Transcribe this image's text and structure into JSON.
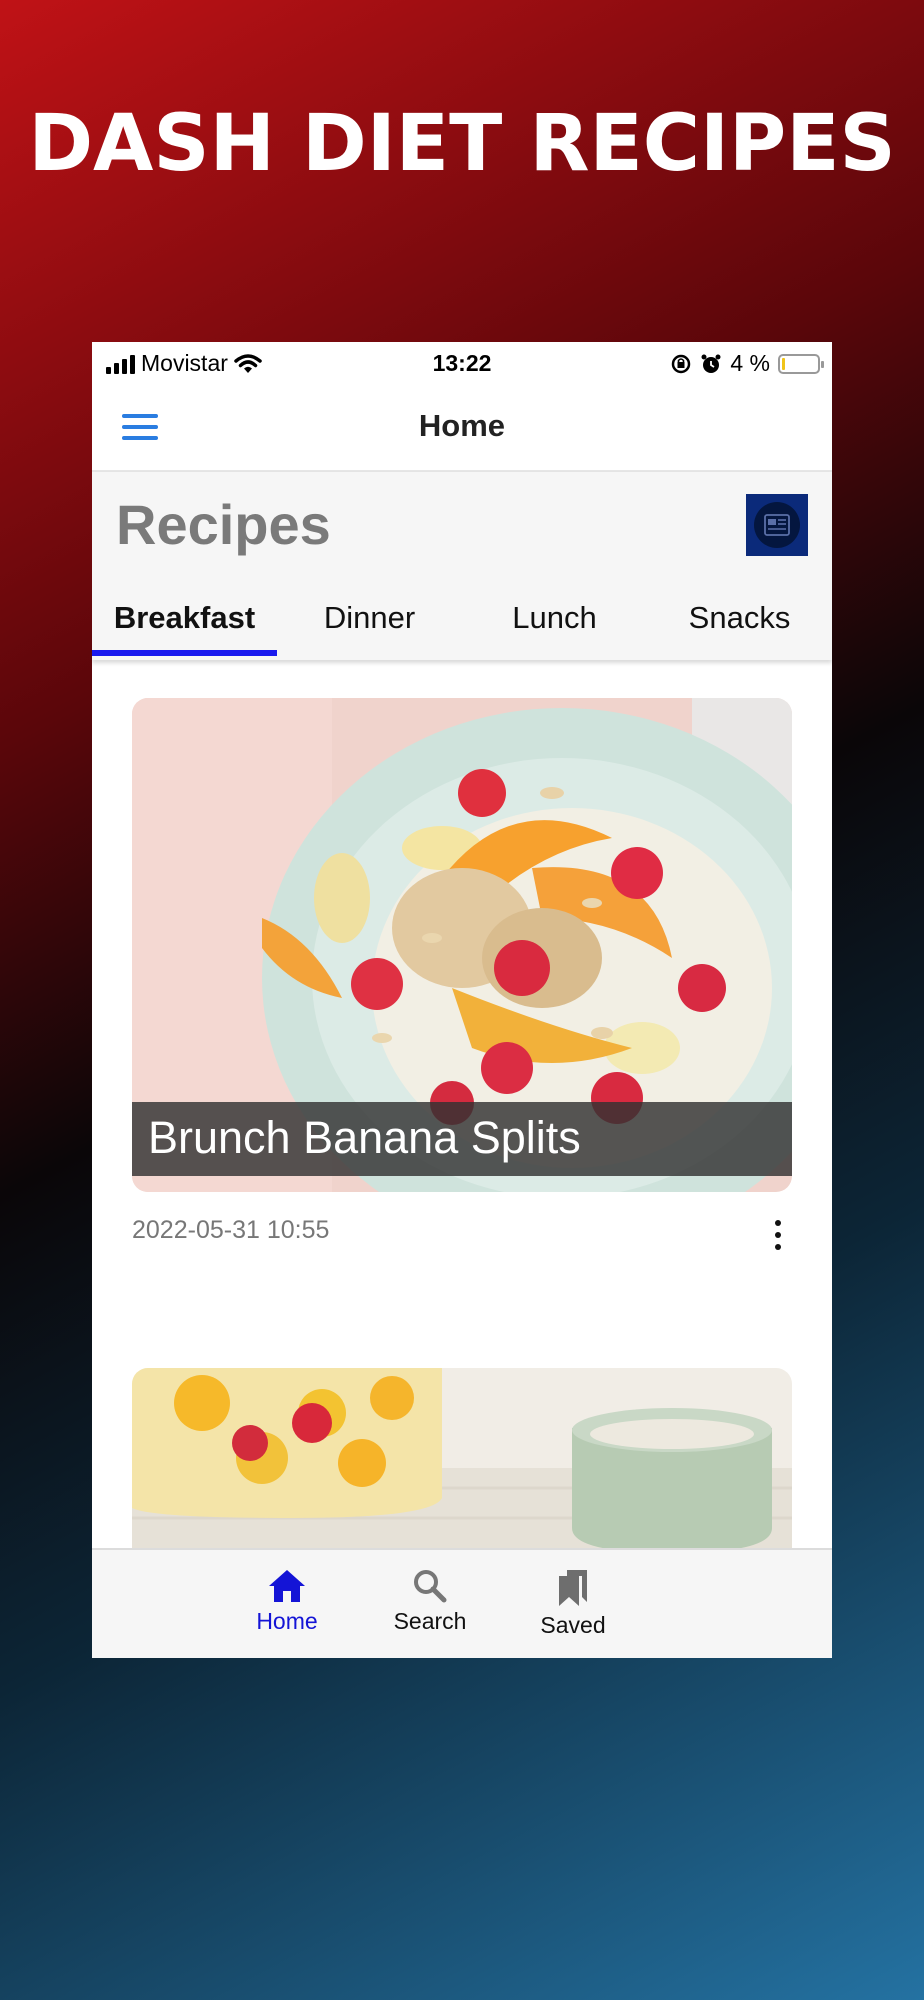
{
  "promo": {
    "title": "DASH DIET RECIPES"
  },
  "status_bar": {
    "carrier": "Movistar",
    "time": "13:22",
    "battery_text": "4 %",
    "battery_level": 0.04
  },
  "nav": {
    "title": "Home",
    "menu_icon": "hamburger-menu-icon"
  },
  "header": {
    "title": "Recipes",
    "news_icon": "newspaper-icon"
  },
  "tabs": [
    {
      "label": "Breakfast",
      "active": true
    },
    {
      "label": "Dinner",
      "active": false
    },
    {
      "label": "Lunch",
      "active": false
    },
    {
      "label": "Snacks",
      "active": false
    }
  ],
  "recipes": [
    {
      "title": "Brunch Banana Splits",
      "date": "2022-05-31 10:55"
    }
  ],
  "tab_bar": {
    "items": [
      {
        "label": "Home",
        "icon": "home-icon",
        "active": true
      },
      {
        "label": "Search",
        "icon": "search-icon",
        "active": false
      },
      {
        "label": "Saved",
        "icon": "bookmarks-icon",
        "active": false
      }
    ]
  },
  "colors": {
    "accent": "#1414d6",
    "menu": "#2a7de1",
    "tab_indicator": "#1a1aee"
  }
}
